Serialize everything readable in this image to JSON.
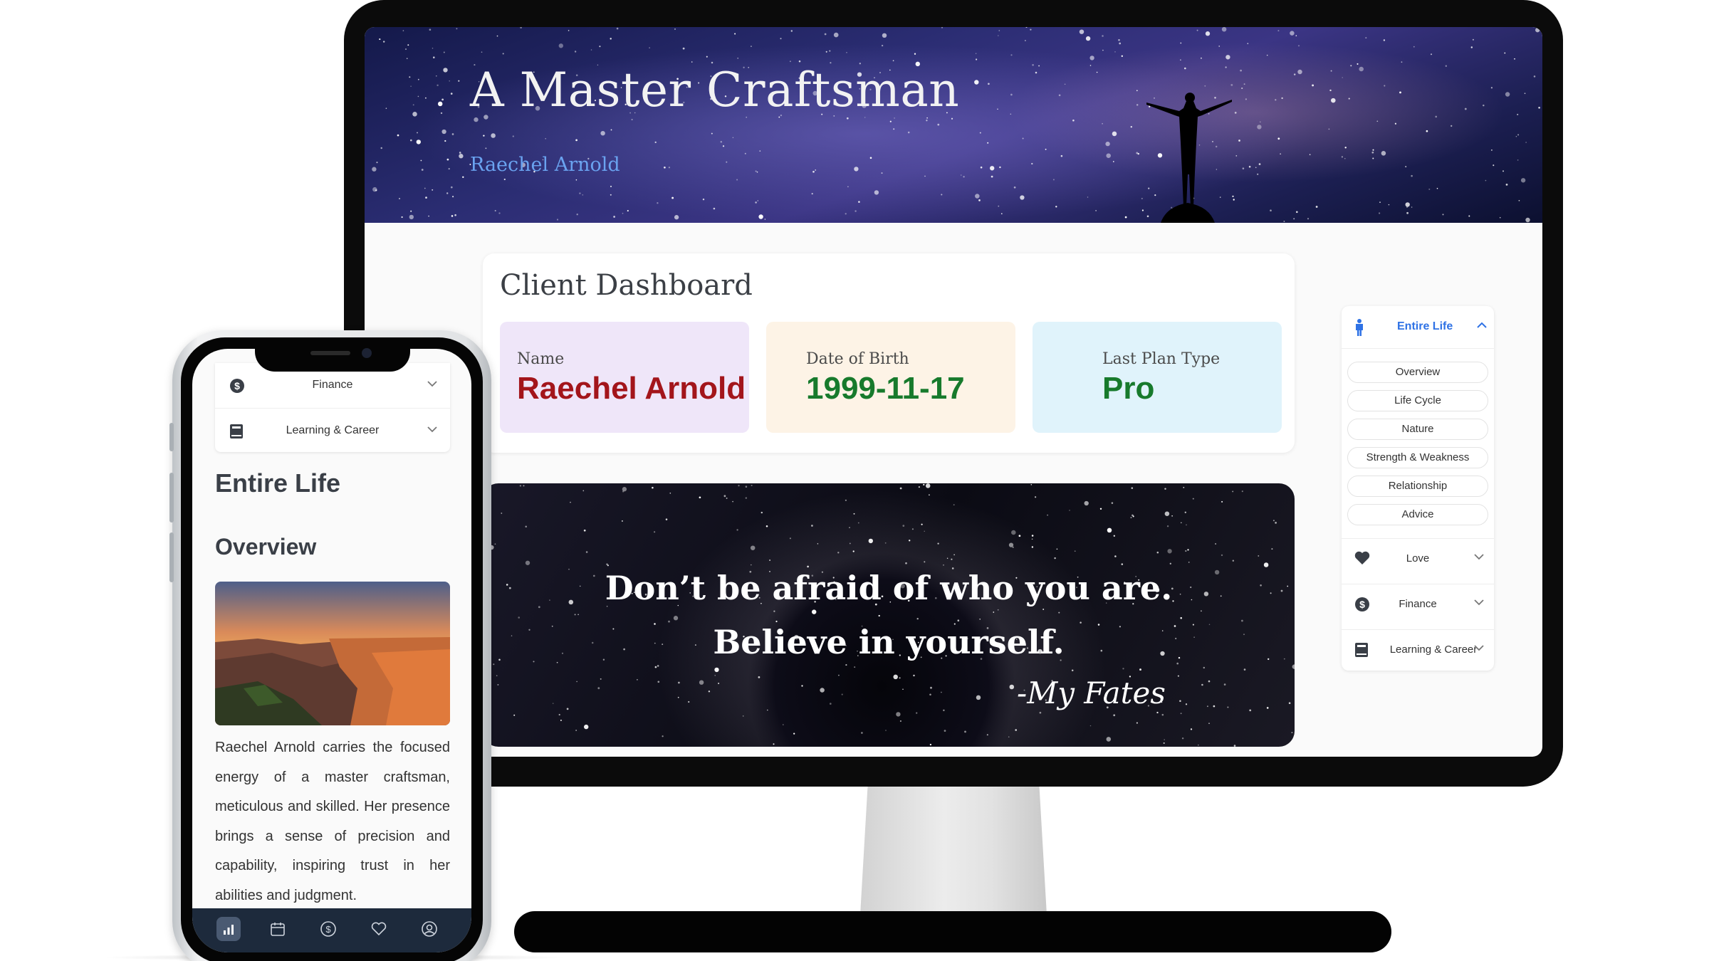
{
  "desktop": {
    "hero": {
      "title": "A Master Craftsman",
      "subtitle": "Raechel Arnold"
    },
    "dashboard": {
      "title": "Client Dashboard",
      "cards": [
        {
          "label": "Name",
          "value": "Raechel Arnold"
        },
        {
          "label": "Date of Birth",
          "value": "1999-11-17"
        },
        {
          "label": "Last Plan Type",
          "value": "Pro"
        }
      ]
    },
    "quote": {
      "line1": "Don’t be afraid of who you are.",
      "line2": "Believe in yourself.",
      "signature": "-My Fates"
    },
    "side_nav": {
      "header": {
        "label": "Entire Life",
        "icon": "person-icon"
      },
      "sub_items": [
        "Overview",
        "Life Cycle",
        "Nature",
        "Strength & Weakness",
        "Relationship",
        "Advice"
      ],
      "sections": [
        {
          "label": "Love",
          "icon": "heart-icon"
        },
        {
          "label": "Finance",
          "icon": "dollar-icon"
        },
        {
          "label": "Learning & Career",
          "icon": "book-icon"
        }
      ]
    }
  },
  "mobile": {
    "menu": [
      {
        "label": "Finance",
        "icon": "dollar-icon"
      },
      {
        "label": "Learning & Career",
        "icon": "book-icon"
      }
    ],
    "heading": "Entire Life",
    "subheading": "Overview",
    "body": "Raechel Arnold carries the focused energy of a master craftsman, meticulous and skilled. Her presence brings a sense of precision and capability, inspiring trust in her abilities and judgment.",
    "tabbar": [
      "chart-icon",
      "calendar-icon",
      "dollar-icon",
      "heart-icon",
      "profile-icon"
    ]
  },
  "colors": {
    "accent_blue": "#2f72e5",
    "name_red": "#a3151b",
    "value_green": "#177a2c",
    "card_purple": "#efe6f9",
    "card_cream": "#fdf3e6",
    "card_blue": "#e0f3fb",
    "tabbar_navy": "#1d2a3c"
  }
}
